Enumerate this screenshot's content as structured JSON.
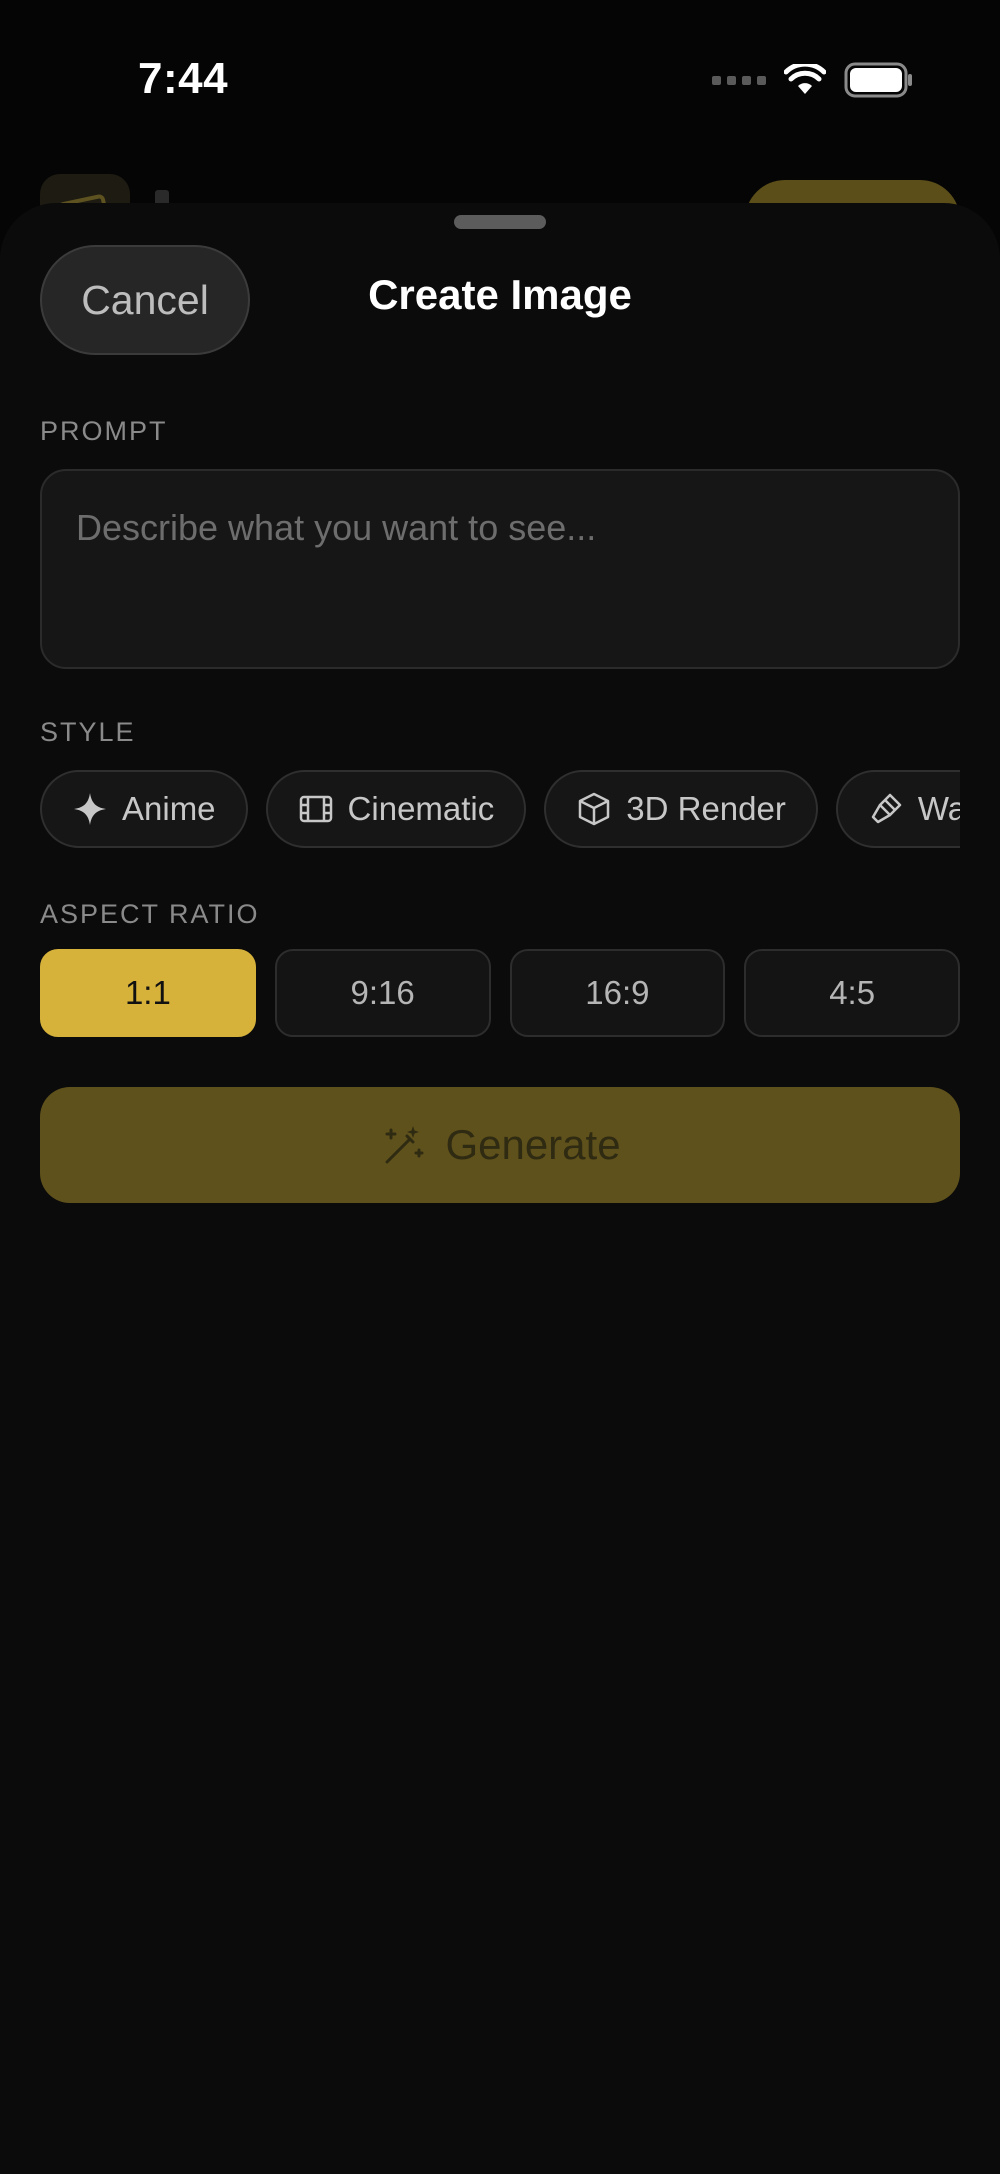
{
  "status_bar": {
    "time": "7:44"
  },
  "sheet": {
    "cancel_label": "Cancel",
    "title": "Create Image"
  },
  "prompt": {
    "section_label": "PROMPT",
    "placeholder": "Describe what you want to see...",
    "value": ""
  },
  "style": {
    "section_label": "STYLE",
    "chips": [
      {
        "label": "Anime",
        "icon": "sparkle-icon"
      },
      {
        "label": "Cinematic",
        "icon": "film-icon"
      },
      {
        "label": "3D Render",
        "icon": "cube-icon"
      },
      {
        "label": "Waterc",
        "icon": "paintbrush-icon"
      }
    ]
  },
  "aspect_ratio": {
    "section_label": "ASPECT RATIO",
    "options": [
      "1:1",
      "9:16",
      "16:9",
      "4:5"
    ],
    "selected": "1:1"
  },
  "generate": {
    "label": "Generate",
    "icon": "magic-wand-icon"
  },
  "colors": {
    "accent": "#d6b23a",
    "generate_disabled": "#5f511b",
    "sheet_background": "#0b0b0b"
  }
}
